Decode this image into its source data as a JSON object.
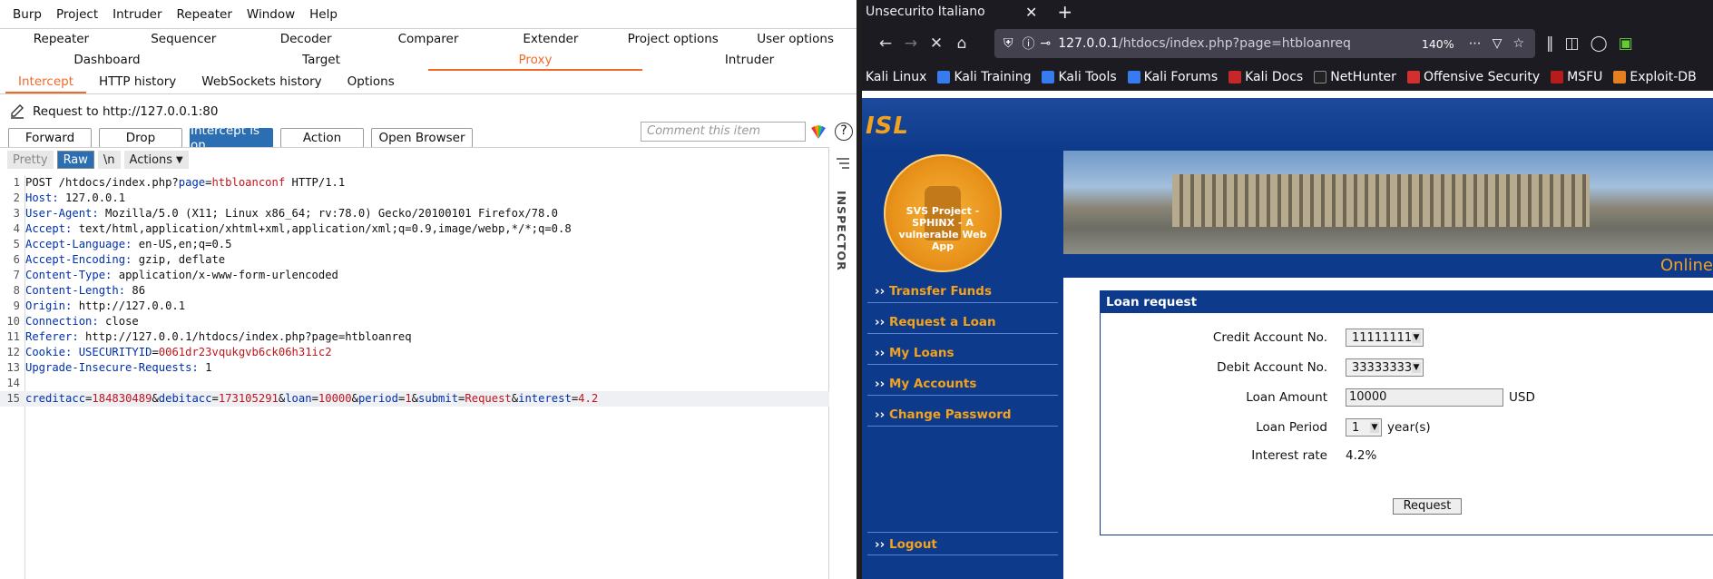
{
  "burp": {
    "menu": [
      "Burp",
      "Project",
      "Intruder",
      "Repeater",
      "Window",
      "Help"
    ],
    "tabs_row1": [
      "Repeater",
      "Sequencer",
      "Decoder",
      "Comparer",
      "Extender",
      "Project options",
      "User options"
    ],
    "tabs_row2": [
      "Dashboard",
      "Target",
      "Proxy",
      "Intruder"
    ],
    "active_tab": "Proxy",
    "subtabs": [
      "Intercept",
      "HTTP history",
      "WebSockets history",
      "Options"
    ],
    "active_subtab": "Intercept",
    "request_to": "Request to http://127.0.0.1:80",
    "buttons": {
      "forward": "Forward",
      "drop": "Drop",
      "intercept": "Intercept is on",
      "action": "Action",
      "open_browser": "Open Browser"
    },
    "comment_placeholder": "Comment this item",
    "help": "?",
    "editor_toolbar": {
      "pretty": "Pretty",
      "raw": "Raw",
      "newline": "\\n",
      "actions": "Actions"
    },
    "inspector_label": "INSPECTOR",
    "request_lines": [
      {
        "n": "1",
        "parts": [
          [
            "",
            "POST /htdocs/index.php?"
          ],
          [
            "k",
            "page"
          ],
          [
            "",
            "="
          ],
          [
            "r",
            "htbloanconf"
          ],
          [
            "",
            " HTTP/1.1"
          ]
        ]
      },
      {
        "n": "2",
        "parts": [
          [
            "k",
            "Host:"
          ],
          [
            "",
            " 127.0.0.1"
          ]
        ]
      },
      {
        "n": "3",
        "parts": [
          [
            "k",
            "User-Agent:"
          ],
          [
            "",
            " Mozilla/5.0 (X11; Linux x86_64; rv:78.0) Gecko/20100101 Firefox/78.0"
          ]
        ]
      },
      {
        "n": "4",
        "parts": [
          [
            "k",
            "Accept:"
          ],
          [
            "",
            " text/html,application/xhtml+xml,application/xml;q=0.9,image/webp,*/*;q=0.8"
          ]
        ]
      },
      {
        "n": "5",
        "parts": [
          [
            "k",
            "Accept-Language:"
          ],
          [
            "",
            " en-US,en;q=0.5"
          ]
        ]
      },
      {
        "n": "6",
        "parts": [
          [
            "k",
            "Accept-Encoding:"
          ],
          [
            "",
            " gzip, deflate"
          ]
        ]
      },
      {
        "n": "7",
        "parts": [
          [
            "k",
            "Content-Type:"
          ],
          [
            "",
            " application/x-www-form-urlencoded"
          ]
        ]
      },
      {
        "n": "8",
        "parts": [
          [
            "k",
            "Content-Length:"
          ],
          [
            "",
            " 86"
          ]
        ]
      },
      {
        "n": "9",
        "parts": [
          [
            "k",
            "Origin:"
          ],
          [
            "",
            " http://127.0.0.1"
          ]
        ]
      },
      {
        "n": "10",
        "parts": [
          [
            "k",
            "Connection:"
          ],
          [
            "",
            " close"
          ]
        ]
      },
      {
        "n": "11",
        "parts": [
          [
            "k",
            "Referer:"
          ],
          [
            "",
            " http://127.0.0.1/htdocs/index.php?page=htbloanreq"
          ]
        ]
      },
      {
        "n": "12",
        "parts": [
          [
            "k",
            "Cookie:"
          ],
          [
            "",
            " "
          ],
          [
            "k",
            "USECURITYID"
          ],
          [
            "",
            "="
          ],
          [
            "r",
            "0061dr23vqukgvb6ck06h31ic2"
          ]
        ]
      },
      {
        "n": "13",
        "parts": [
          [
            "k",
            "Upgrade-Insecure-Requests:"
          ],
          [
            "",
            " 1"
          ]
        ]
      },
      {
        "n": "14",
        "parts": []
      },
      {
        "n": "15",
        "parts": [
          [
            "k",
            "creditacc"
          ],
          [
            "",
            "="
          ],
          [
            "r",
            "184830489"
          ],
          [
            "",
            "&"
          ],
          [
            "k",
            "debitacc"
          ],
          [
            "",
            "="
          ],
          [
            "r",
            "173105291"
          ],
          [
            "",
            "&"
          ],
          [
            "k",
            "loan"
          ],
          [
            "",
            "="
          ],
          [
            "r",
            "10000"
          ],
          [
            "",
            "&"
          ],
          [
            "k",
            "period"
          ],
          [
            "",
            "="
          ],
          [
            "r",
            "1"
          ],
          [
            "",
            "&"
          ],
          [
            "k",
            "submit"
          ],
          [
            "",
            "="
          ],
          [
            "r",
            "Request"
          ],
          [
            "",
            "&"
          ],
          [
            "k",
            "interest"
          ],
          [
            "",
            "="
          ],
          [
            "r",
            "4.2"
          ]
        ]
      }
    ]
  },
  "firefox": {
    "tab_title": "Unsecurito Italiano",
    "url_host": "127.0.0.1",
    "url_path": "/htdocs/index.php?page=htbloanreq",
    "zoom": "140%",
    "bookmarks": [
      "Kali Linux",
      "Kali Training",
      "Kali Tools",
      "Kali Forums",
      "Kali Docs",
      "NetHunter",
      "Offensive Security",
      "MSFU",
      "Exploit-DB"
    ],
    "colors": {
      "accent": "#f3a21e",
      "nav_bg": "#0d3a8a"
    }
  },
  "site": {
    "logo": "ISL",
    "sphinx_text": "SVS Project - SPHINX - A vulnerable Web App",
    "online": "Online",
    "nav": [
      "Transfer Funds",
      "Request a Loan",
      "My Loans",
      "My Accounts",
      "Change Password"
    ],
    "logout": "Logout",
    "form": {
      "title": "Loan request",
      "credit_label": "Credit Account No.",
      "credit_value": "11111111",
      "debit_label": "Debit Account No.",
      "debit_value": "33333333",
      "amount_label": "Loan Amount",
      "amount_value": "10000",
      "currency": "USD",
      "period_label": "Loan Period",
      "period_value": "1",
      "period_unit": "year(s)",
      "interest_label": "Interest rate",
      "interest_value": "4.2%",
      "submit": "Request"
    }
  }
}
